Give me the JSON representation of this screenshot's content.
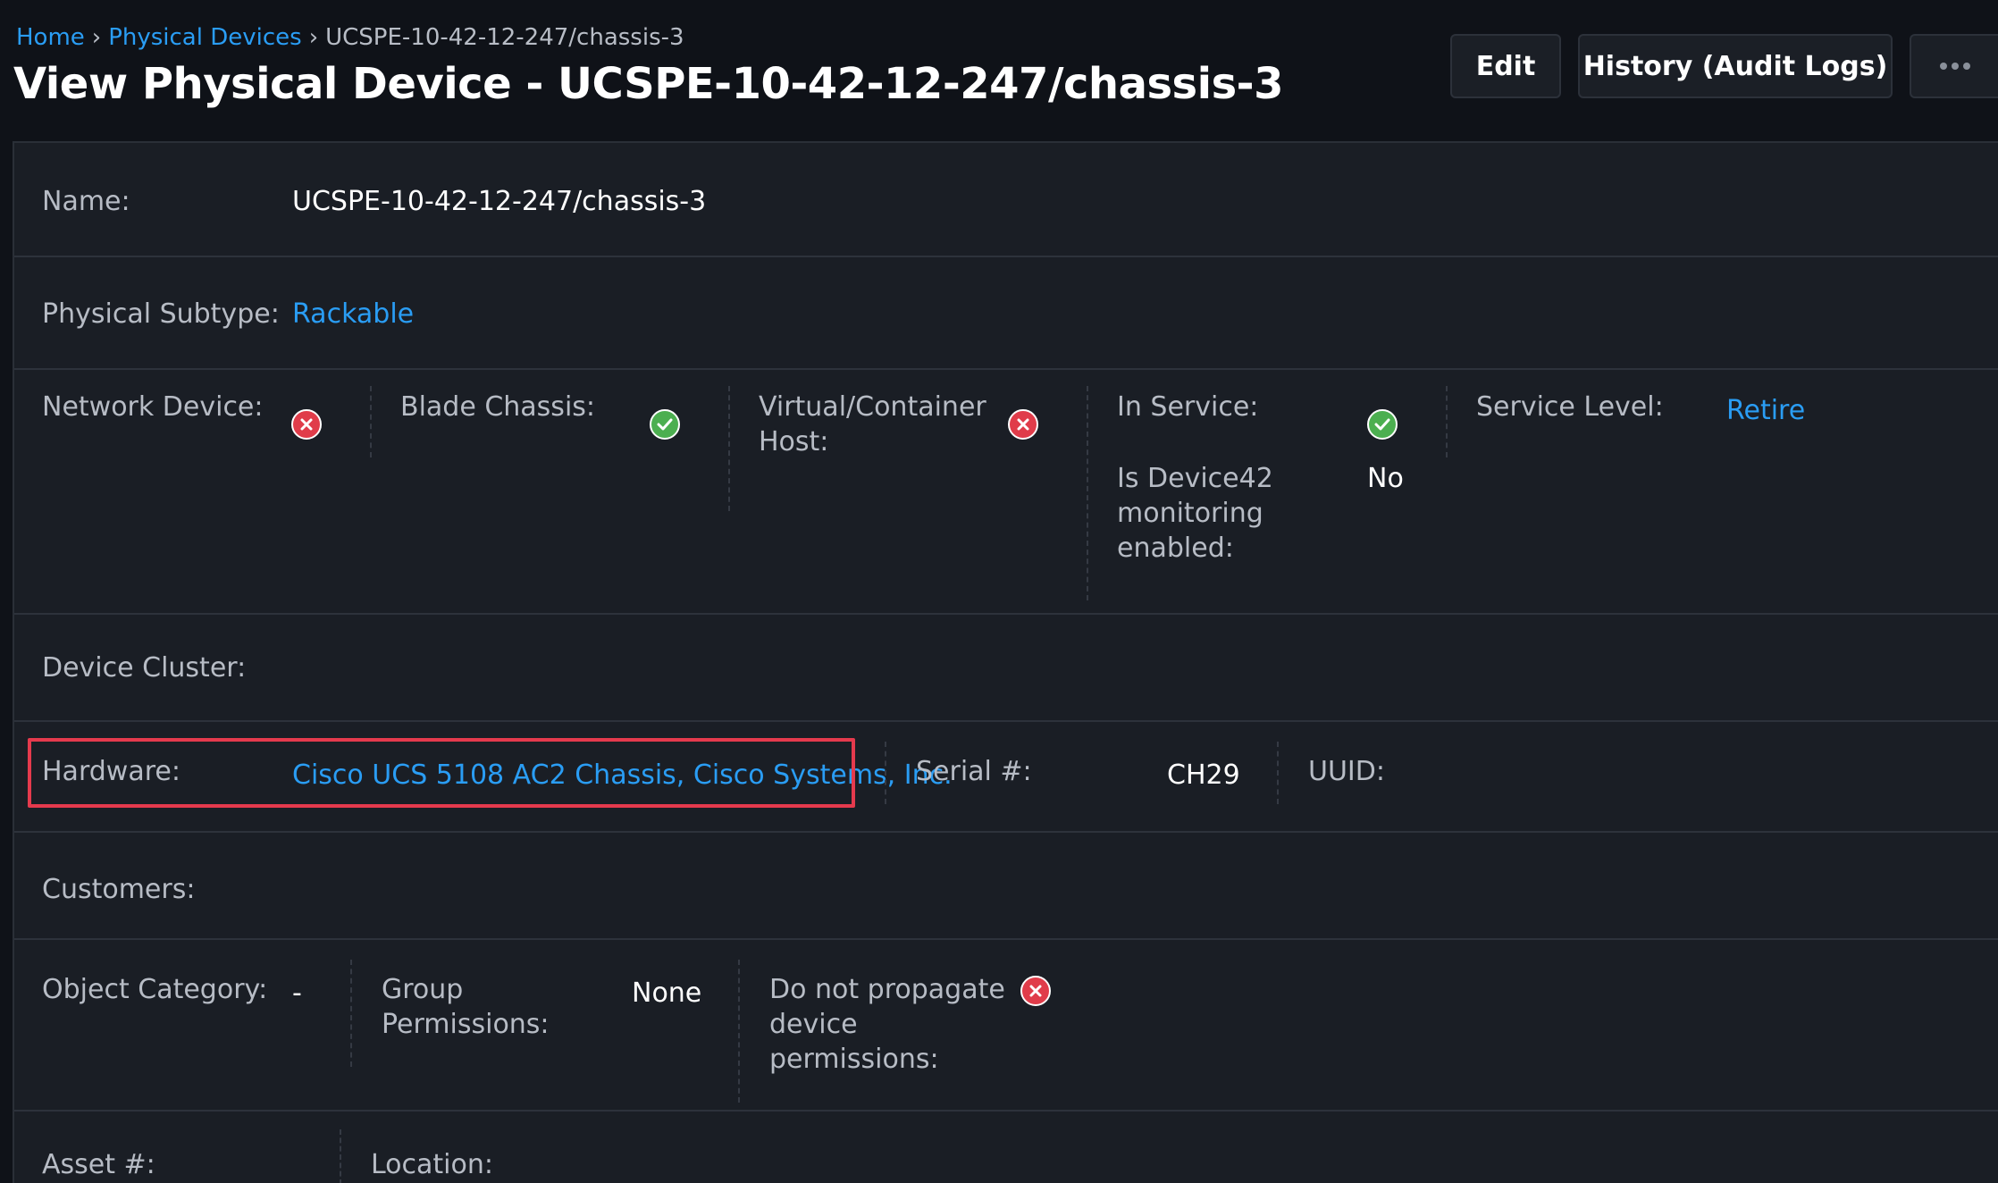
{
  "breadcrumb": {
    "home": "Home",
    "sep1": "›",
    "physical_devices": "Physical Devices",
    "sep2": "›",
    "current": "UCSPE-10-42-12-247/chassis-3"
  },
  "page": {
    "title": "View Physical Device - UCSPE-10-42-12-247/chassis-3"
  },
  "toolbar": {
    "edit_label": "Edit",
    "history_label": "History (Audit Logs)",
    "more_icon": "ellipsis-icon"
  },
  "details": {
    "name": {
      "label": "Name:",
      "value": "UCSPE-10-42-12-247/chassis-3"
    },
    "physical_subtype": {
      "label": "Physical Subtype:",
      "value": "Rackable"
    },
    "network_device": {
      "label": "Network Device:",
      "icon": "x-circle-icon",
      "status": "no"
    },
    "blade_chassis": {
      "label": "Blade Chassis:",
      "icon": "check-circle-icon",
      "status": "yes"
    },
    "virtual_host": {
      "label_line1": "Virtual/Container",
      "label_line2": "Host:",
      "icon": "x-circle-icon",
      "status": "no"
    },
    "in_service": {
      "label": "In Service:",
      "icon": "check-circle-icon",
      "status": "yes"
    },
    "monitoring": {
      "label_line1": "Is Device42",
      "label_line2": "monitoring",
      "label_line3": "enabled:",
      "value": "No"
    },
    "service_level": {
      "label": "Service Level:",
      "value": "Retire"
    },
    "device_cluster": {
      "label": "Device Cluster:"
    },
    "hardware": {
      "label": "Hardware:",
      "value": "Cisco UCS 5108 AC2 Chassis, Cisco Systems, Inc."
    },
    "serial": {
      "label": "Serial #:",
      "value": "CH29"
    },
    "uuid": {
      "label": "UUID:"
    },
    "customers": {
      "label": "Customers:"
    },
    "object_category": {
      "label": "Object Category:",
      "value": "-"
    },
    "group_permissions": {
      "label_line1": "Group",
      "label_line2": "Permissions:",
      "value": "None"
    },
    "propagate": {
      "label_line1": "Do not propagate",
      "label_line2": "device",
      "label_line3": "permissions:",
      "icon": "x-circle-icon",
      "status": "no"
    },
    "asset": {
      "label": "Asset #:"
    },
    "location": {
      "label": "Location:"
    }
  },
  "colors": {
    "background": "#0f1218",
    "panel": "#1a1e25",
    "link": "#2a9df4",
    "label": "#b7bcc5",
    "error": "#e03c4a",
    "success": "#4caf50",
    "highlight": "#e53a4d"
  }
}
